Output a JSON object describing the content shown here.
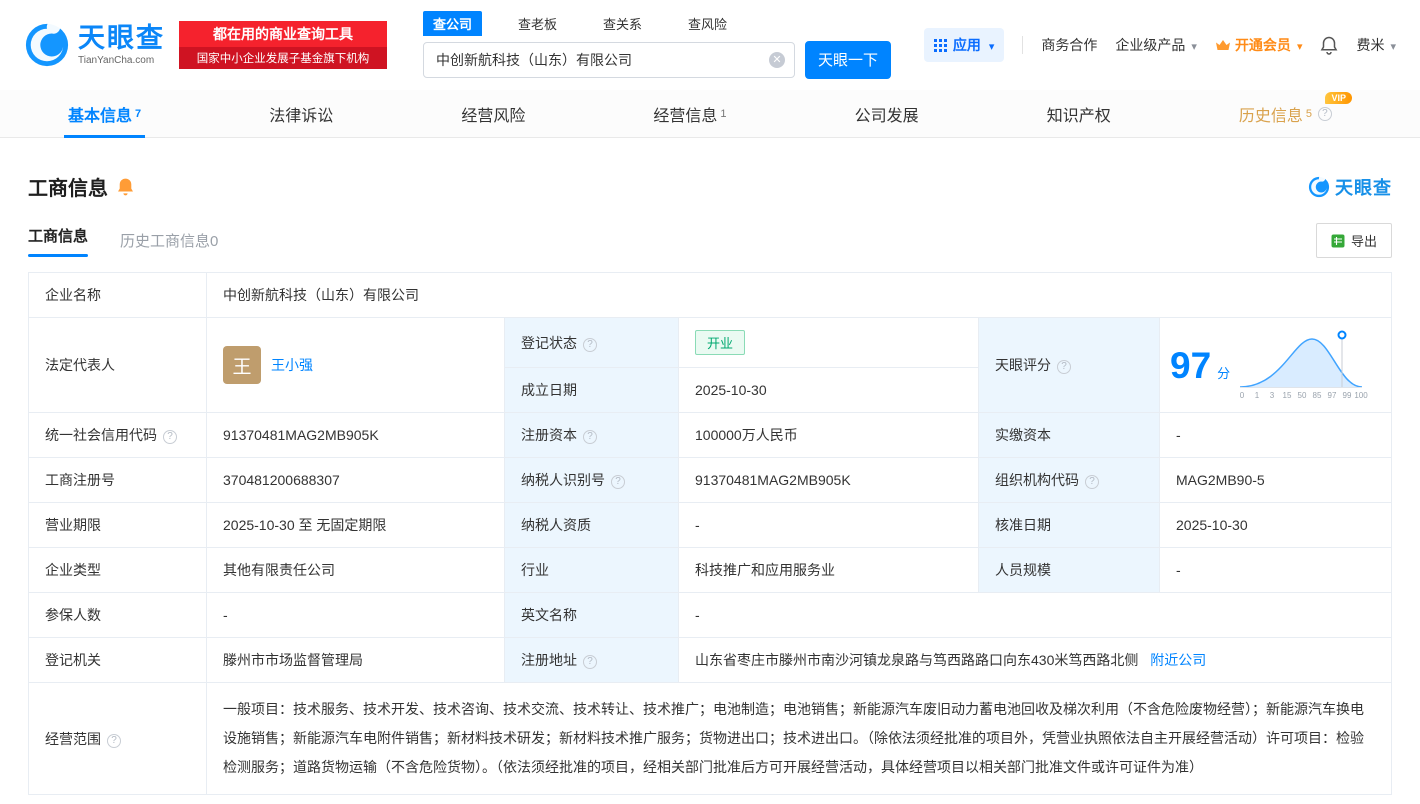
{
  "brand": {
    "name": "天眼查",
    "domain": "TianYanCha.com"
  },
  "promo": {
    "line1": "都在用的商业查询工具",
    "line2": "国家中小企业发展子基金旗下机构"
  },
  "search": {
    "tabs": [
      {
        "label": "查公司"
      },
      {
        "label": "查老板"
      },
      {
        "label": "查关系"
      },
      {
        "label": "查风险"
      }
    ],
    "value": "中创新航科技（山东）有限公司",
    "button": "天眼一下"
  },
  "topmenu": {
    "app": "应用",
    "coop": "商务合作",
    "enterprise": "企业级产品",
    "vip": "开通会员",
    "user": "费米"
  },
  "nav": {
    "tabs": [
      {
        "label": "基本信息",
        "count": "7"
      },
      {
        "label": "法律诉讼",
        "count": ""
      },
      {
        "label": "经营风险",
        "count": ""
      },
      {
        "label": "经营信息",
        "count": "1"
      },
      {
        "label": "公司发展",
        "count": ""
      },
      {
        "label": "知识产权",
        "count": ""
      },
      {
        "label": "历史信息",
        "count": "5",
        "vip": "VIP"
      }
    ]
  },
  "section": {
    "title": "工商信息",
    "brand": "天眼查"
  },
  "subtabs": {
    "current": "工商信息",
    "history": "历史工商信息",
    "history_count": "0",
    "export": "导出"
  },
  "score": {
    "label": "天眼评分",
    "value": "97",
    "unit": "分",
    "axis": [
      "0",
      "1",
      "3",
      "15",
      "50",
      "85",
      "97",
      "99",
      "100"
    ]
  },
  "table": {
    "company_name_label": "企业名称",
    "company_name": "中创新航科技（山东）有限公司",
    "legal_rep_label": "法定代表人",
    "legal_rep_avatar": "王",
    "legal_rep": "王小强",
    "reg_status_label": "登记状态",
    "reg_status": "开业",
    "est_date_label": "成立日期",
    "est_date": "2025-10-30",
    "uscc_label": "统一社会信用代码",
    "uscc": "91370481MAG2MB905K",
    "reg_capital_label": "注册资本",
    "reg_capital": "100000万人民币",
    "paid_capital_label": "实缴资本",
    "paid_capital": "-",
    "reg_no_label": "工商注册号",
    "reg_no": "370481200688307",
    "taxpayer_id_label": "纳税人识别号",
    "taxpayer_id": "91370481MAG2MB905K",
    "org_code_label": "组织机构代码",
    "org_code": "MAG2MB90-5",
    "business_term_label": "营业期限",
    "business_term": "2025-10-30 至 无固定期限",
    "taxpayer_quality_label": "纳税人资质",
    "taxpayer_quality": "-",
    "approval_date_label": "核准日期",
    "approval_date": "2025-10-30",
    "company_type_label": "企业类型",
    "company_type": "其他有限责任公司",
    "industry_label": "行业",
    "industry": "科技推广和应用服务业",
    "staff_size_label": "人员规模",
    "staff_size": "-",
    "insured_label": "参保人数",
    "insured": "-",
    "english_name_label": "英文名称",
    "english_name": "-",
    "reg_authority_label": "登记机关",
    "reg_authority": "滕州市市场监督管理局",
    "address_label": "注册地址",
    "address": "山东省枣庄市滕州市南沙河镇龙泉路与笃西路路口向东430米笃西路北侧",
    "nearby_link": "附近公司",
    "business_scope_label": "经营范围",
    "business_scope": "一般项目：技术服务、技术开发、技术咨询、技术交流、技术转让、技术推广；电池制造；电池销售；新能源汽车废旧动力蓄电池回收及梯次利用（不含危险废物经营）；新能源汽车换电设施销售；新能源汽车电附件销售；新材料技术研发；新材料技术推广服务；货物进出口；技术进出口。（除依法须经批准的项目外，凭营业执照依法自主开展经营活动）许可项目：检验检测服务；道路货物运输（不含危险货物）。（依法须经批准的项目，经相关部门批准后方可开展经营活动，具体经营项目以相关部门批准文件或许可证件为准）"
  }
}
